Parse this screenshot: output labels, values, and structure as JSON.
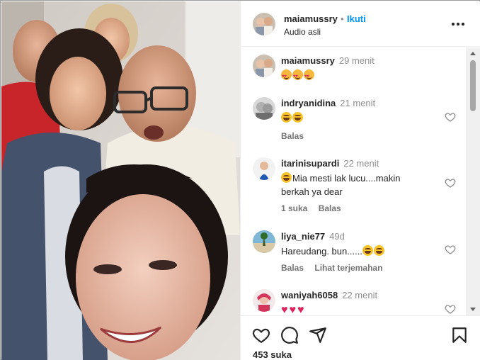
{
  "colors": {
    "accent": "#0095f6",
    "text": "#262626",
    "muted": "#8e8e8e"
  },
  "post": {
    "username": "maiamussry",
    "separator": "•",
    "follow_label": "Ikuti",
    "audio": "Audio asli",
    "more_icon": "more-horizontal-icon"
  },
  "comments": [
    {
      "user": "maiamussry",
      "time": "29 menit",
      "emojis": [
        "smiling-face-with-hearts",
        "smiling-face-with-hearts",
        "smiling-face-with-hearts"
      ],
      "text": "",
      "actions": []
    },
    {
      "user": "indryanidina",
      "time": "21 menit",
      "emojis": [
        "laughing-face",
        "laughing-face"
      ],
      "text": "",
      "actions": [
        "Balas"
      ]
    },
    {
      "user": "itarinisupardi",
      "time": "22 menit",
      "emojis": [
        "laughing-face"
      ],
      "text": "Mia mesti lak lucu....makin berkah ya dear",
      "actions": [
        "1 suka",
        "Balas"
      ]
    },
    {
      "user": "liya_nie77",
      "time": "49d",
      "emojis": [
        "laughing-face",
        "laughing-face"
      ],
      "text": "Hareudang. bun......",
      "actions": [
        "Balas",
        "Lihat terjemahan"
      ]
    },
    {
      "user": "waniyah6058",
      "time": "22 menit",
      "emojis": [
        "red-heart",
        "red-heart",
        "red-heart"
      ],
      "text": "",
      "actions": []
    }
  ],
  "footer": {
    "icons": [
      "heart-icon",
      "comment-icon",
      "share-icon",
      "bookmark-icon"
    ],
    "likes": "453 suka"
  }
}
